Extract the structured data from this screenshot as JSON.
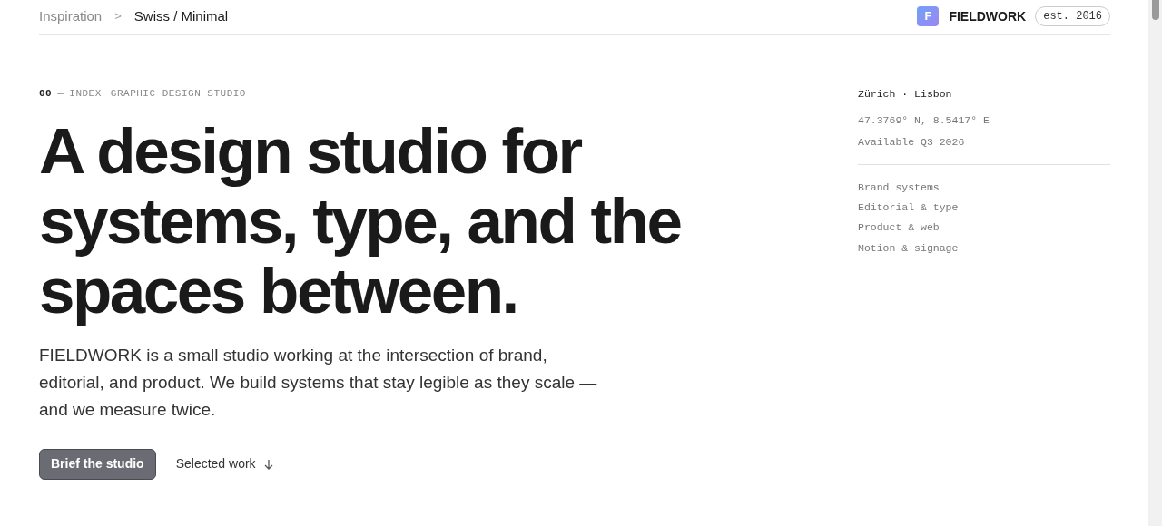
{
  "breadcrumb": {
    "parent": "Inspiration",
    "separator": ">",
    "current": "Swiss / Minimal"
  },
  "brand": {
    "logo_letter": "F",
    "name": "FIELDWORK",
    "badge": "est. 2016"
  },
  "eyebrow": {
    "number": "00",
    "dash": "—",
    "section": "INDEX",
    "tagline": "GRAPHIC DESIGN STUDIO"
  },
  "headline": "A design studio for systems, type, and the spaces between.",
  "intro": "FIELDWORK is a small studio working at the intersection of brand, editorial, and product. We build systems that stay legible as they scale — and we measure twice.",
  "actions": {
    "primary": "Brief the studio",
    "secondary": "Selected work"
  },
  "sidebar": {
    "cities": "Zürich · Lisbon",
    "coordinates": "47.3769° N, 8.5417° E",
    "availability": "Available Q3 2026",
    "services": [
      "Brand systems",
      "Editorial & type",
      "Product & web",
      "Motion & signage"
    ]
  }
}
